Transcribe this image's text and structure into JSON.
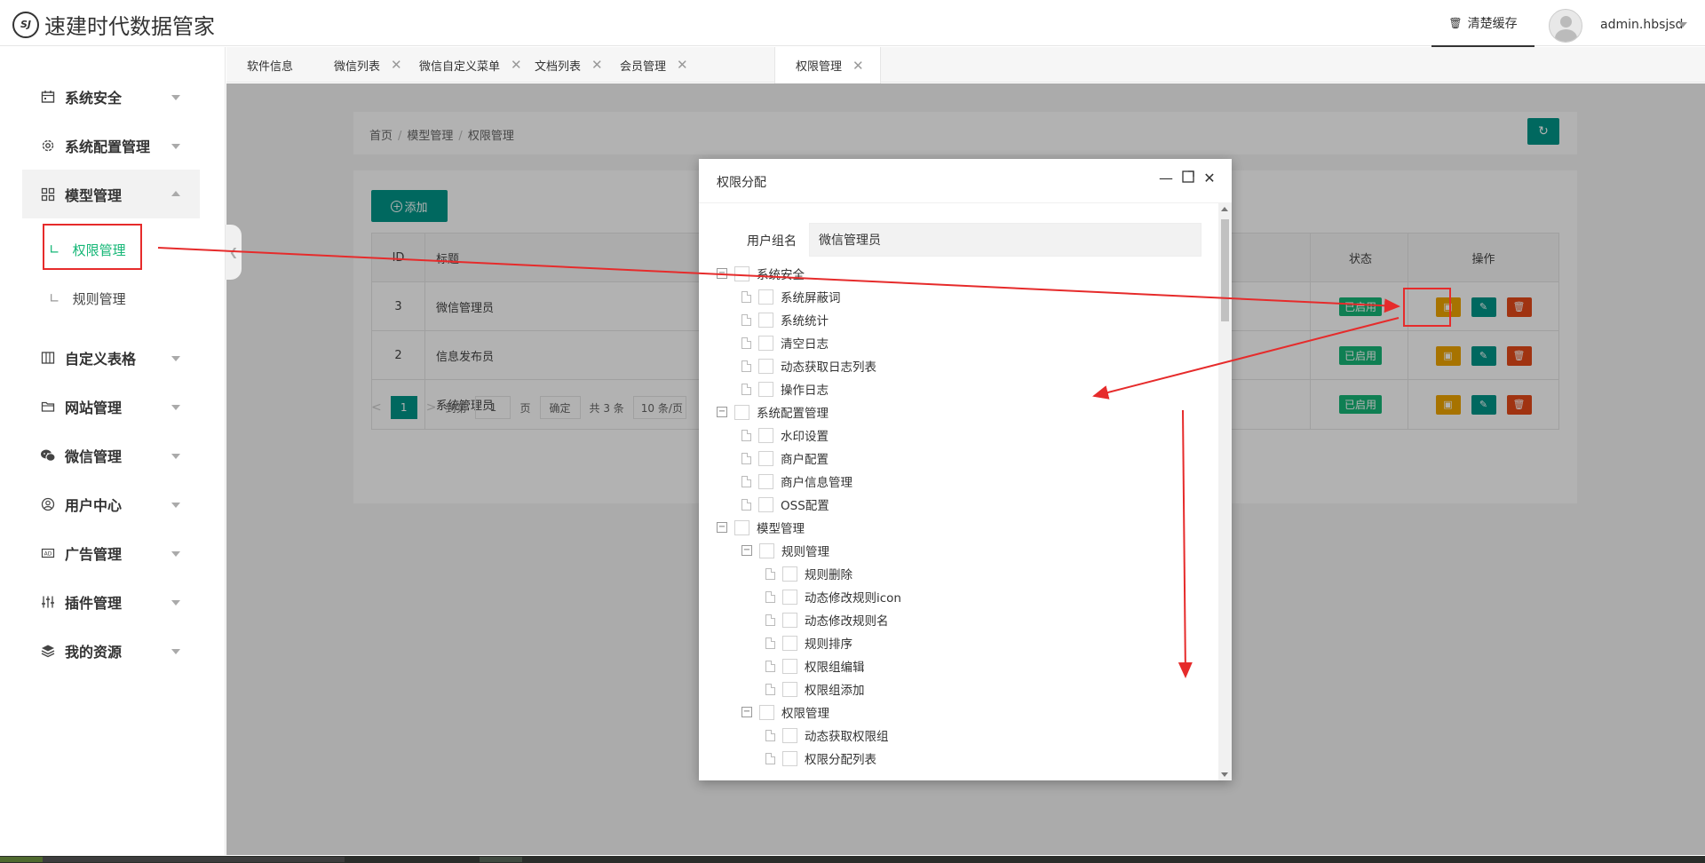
{
  "app": {
    "logo_mark": "SJ",
    "title": "速建时代数据管家"
  },
  "header": {
    "clear_cache_icon": "trash-icon",
    "clear_cache": "清楚缓存",
    "username": "admin.hbsjsd"
  },
  "sidebar": {
    "items": [
      {
        "label": "系统安全",
        "icon": "calendar-icon"
      },
      {
        "label": "系统配置管理",
        "icon": "gear-icon"
      },
      {
        "label": "模型管理",
        "icon": "grid-icon"
      },
      {
        "label": "自定义表格",
        "icon": "columns-icon"
      },
      {
        "label": "网站管理",
        "icon": "folder-icon"
      },
      {
        "label": "微信管理",
        "icon": "wechat-icon"
      },
      {
        "label": "用户中心",
        "icon": "user-circle-icon"
      },
      {
        "label": "广告管理",
        "icon": "ad-icon"
      },
      {
        "label": "插件管理",
        "icon": "sliders-icon"
      },
      {
        "label": "我的资源",
        "icon": "layers-icon"
      }
    ],
    "subitems": [
      {
        "label": "权限管理",
        "active": true
      },
      {
        "label": "规则管理",
        "active": false
      }
    ]
  },
  "tabs": [
    {
      "label": "软件信息",
      "closable": false
    },
    {
      "label": "微信列表",
      "closable": true
    },
    {
      "label": "微信自定义菜单",
      "closable": true
    },
    {
      "label": "文档列表",
      "closable": true
    },
    {
      "label": "会员管理",
      "closable": true
    },
    {
      "label": "权限管理",
      "closable": true,
      "active": true
    }
  ],
  "breadcrumb": [
    "首页",
    "模型管理",
    "权限管理"
  ],
  "toolbar": {
    "add_label": "添加"
  },
  "table": {
    "headers": {
      "id": "ID",
      "title": "标题",
      "status": "状态",
      "ops": "操作"
    },
    "rows": [
      {
        "id": "3",
        "title": "微信管理员",
        "status": "已启用"
      },
      {
        "id": "2",
        "title": "信息发布员",
        "status": "已启用"
      },
      {
        "id": "1",
        "title": "系统管理员",
        "status": "已启用"
      }
    ]
  },
  "pager": {
    "current": "1",
    "goto_label": "到第",
    "goto_value": "1",
    "page_label": "页",
    "confirm": "确定",
    "total": "共 3 条",
    "page_size": "10 条/页"
  },
  "modal": {
    "title": "权限分配",
    "form_label": "用户组名",
    "form_value": "微信管理员",
    "tree": [
      {
        "label": "系统安全",
        "level": 0,
        "type": "group"
      },
      {
        "label": "系统屏蔽词",
        "level": 1,
        "type": "leaf"
      },
      {
        "label": "系统统计",
        "level": 1,
        "type": "leaf"
      },
      {
        "label": "清空日志",
        "level": 1,
        "type": "leaf"
      },
      {
        "label": "动态获取日志列表",
        "level": 1,
        "type": "leaf"
      },
      {
        "label": "操作日志",
        "level": 1,
        "type": "leaf"
      },
      {
        "label": "系统配置管理",
        "level": 0,
        "type": "group"
      },
      {
        "label": "水印设置",
        "level": 1,
        "type": "leaf"
      },
      {
        "label": "商户配置",
        "level": 1,
        "type": "leaf"
      },
      {
        "label": "商户信息管理",
        "level": 1,
        "type": "leaf"
      },
      {
        "label": "OSS配置",
        "level": 1,
        "type": "leaf"
      },
      {
        "label": "模型管理",
        "level": 0,
        "type": "group"
      },
      {
        "label": "规则管理",
        "level": 1,
        "type": "group"
      },
      {
        "label": "规则删除",
        "level": 2,
        "type": "leaf"
      },
      {
        "label": "动态修改规则icon",
        "level": 2,
        "type": "leaf"
      },
      {
        "label": "动态修改规则名",
        "level": 2,
        "type": "leaf"
      },
      {
        "label": "规则排序",
        "level": 2,
        "type": "leaf"
      },
      {
        "label": "权限组编辑",
        "level": 2,
        "type": "leaf"
      },
      {
        "label": "权限组添加",
        "level": 2,
        "type": "leaf"
      },
      {
        "label": "权限管理",
        "level": 1,
        "type": "group"
      },
      {
        "label": "动态获取权限组",
        "level": 2,
        "type": "leaf"
      },
      {
        "label": "权限分配列表",
        "level": 2,
        "type": "leaf"
      }
    ]
  },
  "colors": {
    "primary": "#009688",
    "active_green": "#16b777",
    "warn": "#f0a500",
    "danger": "#e64a19",
    "annotation_red": "#e62b2b"
  }
}
